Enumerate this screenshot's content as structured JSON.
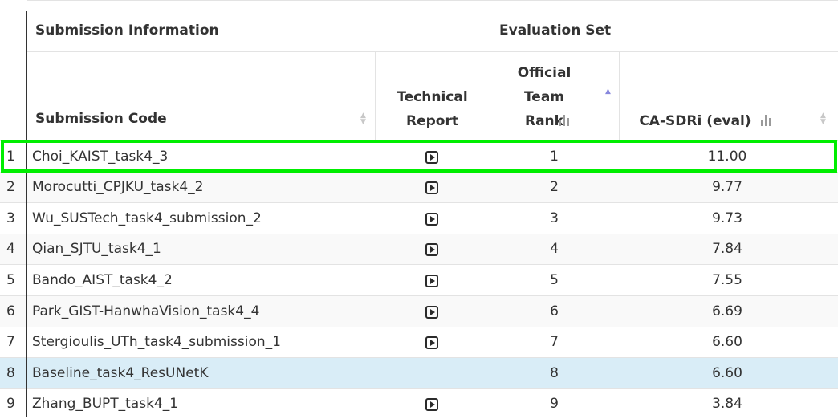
{
  "groups": {
    "submission": "Submission Information",
    "evaluation": "Evaluation Set"
  },
  "columns": {
    "code": "Submission Code",
    "report_l1": "Technical",
    "report_l2": "Report",
    "rank_l1": "Official",
    "rank_l2": "Team",
    "rank_l3": "Rank",
    "sdri": "CA-SDRi (eval)"
  },
  "rows": [
    {
      "idx": "1",
      "code": "Choi_KAIST_task4_3",
      "has_report": true,
      "rank": "1",
      "sdri": "11.00",
      "highlight": true
    },
    {
      "idx": "2",
      "code": "Morocutti_CPJKU_task4_2",
      "has_report": true,
      "rank": "2",
      "sdri": "9.77"
    },
    {
      "idx": "3",
      "code": "Wu_SUSTech_task4_submission_2",
      "has_report": true,
      "rank": "3",
      "sdri": "9.73"
    },
    {
      "idx": "4",
      "code": "Qian_SJTU_task4_1",
      "has_report": true,
      "rank": "4",
      "sdri": "7.84"
    },
    {
      "idx": "5",
      "code": "Bando_AIST_task4_2",
      "has_report": true,
      "rank": "5",
      "sdri": "7.55"
    },
    {
      "idx": "6",
      "code": "Park_GIST-HanwhaVision_task4_4",
      "has_report": true,
      "rank": "6",
      "sdri": "6.69"
    },
    {
      "idx": "7",
      "code": "Stergioulis_UTh_task4_submission_1",
      "has_report": true,
      "rank": "7",
      "sdri": "6.60"
    },
    {
      "idx": "8",
      "code": "Baseline_task4_ResUNetK",
      "has_report": false,
      "rank": "8",
      "sdri": "6.60",
      "baseline": true
    },
    {
      "idx": "9",
      "code": "Zhang_BUPT_task4_1",
      "has_report": true,
      "rank": "9",
      "sdri": "3.84"
    }
  ],
  "colors": {
    "highlight_border": "#00ee00",
    "baseline_bg": "#d9edf7",
    "stripe_bg": "#f9f9f9"
  }
}
